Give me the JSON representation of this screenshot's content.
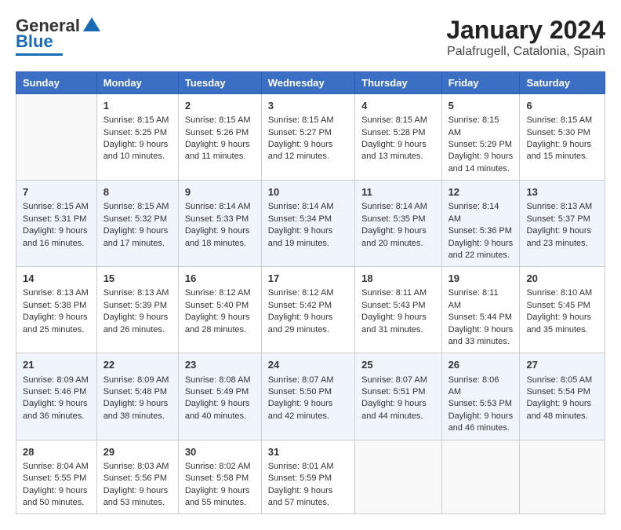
{
  "logo": {
    "general": "General",
    "blue": "Blue"
  },
  "title": "January 2024",
  "subtitle": "Palafrugell, Catalonia, Spain",
  "days_of_week": [
    "Sunday",
    "Monday",
    "Tuesday",
    "Wednesday",
    "Thursday",
    "Friday",
    "Saturday"
  ],
  "weeks": [
    [
      {
        "day": "",
        "sunrise": "",
        "sunset": "",
        "daylight": ""
      },
      {
        "day": "1",
        "sunrise": "Sunrise: 8:15 AM",
        "sunset": "Sunset: 5:25 PM",
        "daylight": "Daylight: 9 hours and 10 minutes."
      },
      {
        "day": "2",
        "sunrise": "Sunrise: 8:15 AM",
        "sunset": "Sunset: 5:26 PM",
        "daylight": "Daylight: 9 hours and 11 minutes."
      },
      {
        "day": "3",
        "sunrise": "Sunrise: 8:15 AM",
        "sunset": "Sunset: 5:27 PM",
        "daylight": "Daylight: 9 hours and 12 minutes."
      },
      {
        "day": "4",
        "sunrise": "Sunrise: 8:15 AM",
        "sunset": "Sunset: 5:28 PM",
        "daylight": "Daylight: 9 hours and 13 minutes."
      },
      {
        "day": "5",
        "sunrise": "Sunrise: 8:15 AM",
        "sunset": "Sunset: 5:29 PM",
        "daylight": "Daylight: 9 hours and 14 minutes."
      },
      {
        "day": "6",
        "sunrise": "Sunrise: 8:15 AM",
        "sunset": "Sunset: 5:30 PM",
        "daylight": "Daylight: 9 hours and 15 minutes."
      }
    ],
    [
      {
        "day": "7",
        "sunrise": "Sunrise: 8:15 AM",
        "sunset": "Sunset: 5:31 PM",
        "daylight": "Daylight: 9 hours and 16 minutes."
      },
      {
        "day": "8",
        "sunrise": "Sunrise: 8:15 AM",
        "sunset": "Sunset: 5:32 PM",
        "daylight": "Daylight: 9 hours and 17 minutes."
      },
      {
        "day": "9",
        "sunrise": "Sunrise: 8:14 AM",
        "sunset": "Sunset: 5:33 PM",
        "daylight": "Daylight: 9 hours and 18 minutes."
      },
      {
        "day": "10",
        "sunrise": "Sunrise: 8:14 AM",
        "sunset": "Sunset: 5:34 PM",
        "daylight": "Daylight: 9 hours and 19 minutes."
      },
      {
        "day": "11",
        "sunrise": "Sunrise: 8:14 AM",
        "sunset": "Sunset: 5:35 PM",
        "daylight": "Daylight: 9 hours and 20 minutes."
      },
      {
        "day": "12",
        "sunrise": "Sunrise: 8:14 AM",
        "sunset": "Sunset: 5:36 PM",
        "daylight": "Daylight: 9 hours and 22 minutes."
      },
      {
        "day": "13",
        "sunrise": "Sunrise: 8:13 AM",
        "sunset": "Sunset: 5:37 PM",
        "daylight": "Daylight: 9 hours and 23 minutes."
      }
    ],
    [
      {
        "day": "14",
        "sunrise": "Sunrise: 8:13 AM",
        "sunset": "Sunset: 5:38 PM",
        "daylight": "Daylight: 9 hours and 25 minutes."
      },
      {
        "day": "15",
        "sunrise": "Sunrise: 8:13 AM",
        "sunset": "Sunset: 5:39 PM",
        "daylight": "Daylight: 9 hours and 26 minutes."
      },
      {
        "day": "16",
        "sunrise": "Sunrise: 8:12 AM",
        "sunset": "Sunset: 5:40 PM",
        "daylight": "Daylight: 9 hours and 28 minutes."
      },
      {
        "day": "17",
        "sunrise": "Sunrise: 8:12 AM",
        "sunset": "Sunset: 5:42 PM",
        "daylight": "Daylight: 9 hours and 29 minutes."
      },
      {
        "day": "18",
        "sunrise": "Sunrise: 8:11 AM",
        "sunset": "Sunset: 5:43 PM",
        "daylight": "Daylight: 9 hours and 31 minutes."
      },
      {
        "day": "19",
        "sunrise": "Sunrise: 8:11 AM",
        "sunset": "Sunset: 5:44 PM",
        "daylight": "Daylight: 9 hours and 33 minutes."
      },
      {
        "day": "20",
        "sunrise": "Sunrise: 8:10 AM",
        "sunset": "Sunset: 5:45 PM",
        "daylight": "Daylight: 9 hours and 35 minutes."
      }
    ],
    [
      {
        "day": "21",
        "sunrise": "Sunrise: 8:09 AM",
        "sunset": "Sunset: 5:46 PM",
        "daylight": "Daylight: 9 hours and 36 minutes."
      },
      {
        "day": "22",
        "sunrise": "Sunrise: 8:09 AM",
        "sunset": "Sunset: 5:48 PM",
        "daylight": "Daylight: 9 hours and 38 minutes."
      },
      {
        "day": "23",
        "sunrise": "Sunrise: 8:08 AM",
        "sunset": "Sunset: 5:49 PM",
        "daylight": "Daylight: 9 hours and 40 minutes."
      },
      {
        "day": "24",
        "sunrise": "Sunrise: 8:07 AM",
        "sunset": "Sunset: 5:50 PM",
        "daylight": "Daylight: 9 hours and 42 minutes."
      },
      {
        "day": "25",
        "sunrise": "Sunrise: 8:07 AM",
        "sunset": "Sunset: 5:51 PM",
        "daylight": "Daylight: 9 hours and 44 minutes."
      },
      {
        "day": "26",
        "sunrise": "Sunrise: 8:06 AM",
        "sunset": "Sunset: 5:53 PM",
        "daylight": "Daylight: 9 hours and 46 minutes."
      },
      {
        "day": "27",
        "sunrise": "Sunrise: 8:05 AM",
        "sunset": "Sunset: 5:54 PM",
        "daylight": "Daylight: 9 hours and 48 minutes."
      }
    ],
    [
      {
        "day": "28",
        "sunrise": "Sunrise: 8:04 AM",
        "sunset": "Sunset: 5:55 PM",
        "daylight": "Daylight: 9 hours and 50 minutes."
      },
      {
        "day": "29",
        "sunrise": "Sunrise: 8:03 AM",
        "sunset": "Sunset: 5:56 PM",
        "daylight": "Daylight: 9 hours and 53 minutes."
      },
      {
        "day": "30",
        "sunrise": "Sunrise: 8:02 AM",
        "sunset": "Sunset: 5:58 PM",
        "daylight": "Daylight: 9 hours and 55 minutes."
      },
      {
        "day": "31",
        "sunrise": "Sunrise: 8:01 AM",
        "sunset": "Sunset: 5:59 PM",
        "daylight": "Daylight: 9 hours and 57 minutes."
      },
      {
        "day": "",
        "sunrise": "",
        "sunset": "",
        "daylight": ""
      },
      {
        "day": "",
        "sunrise": "",
        "sunset": "",
        "daylight": ""
      },
      {
        "day": "",
        "sunrise": "",
        "sunset": "",
        "daylight": ""
      }
    ]
  ]
}
